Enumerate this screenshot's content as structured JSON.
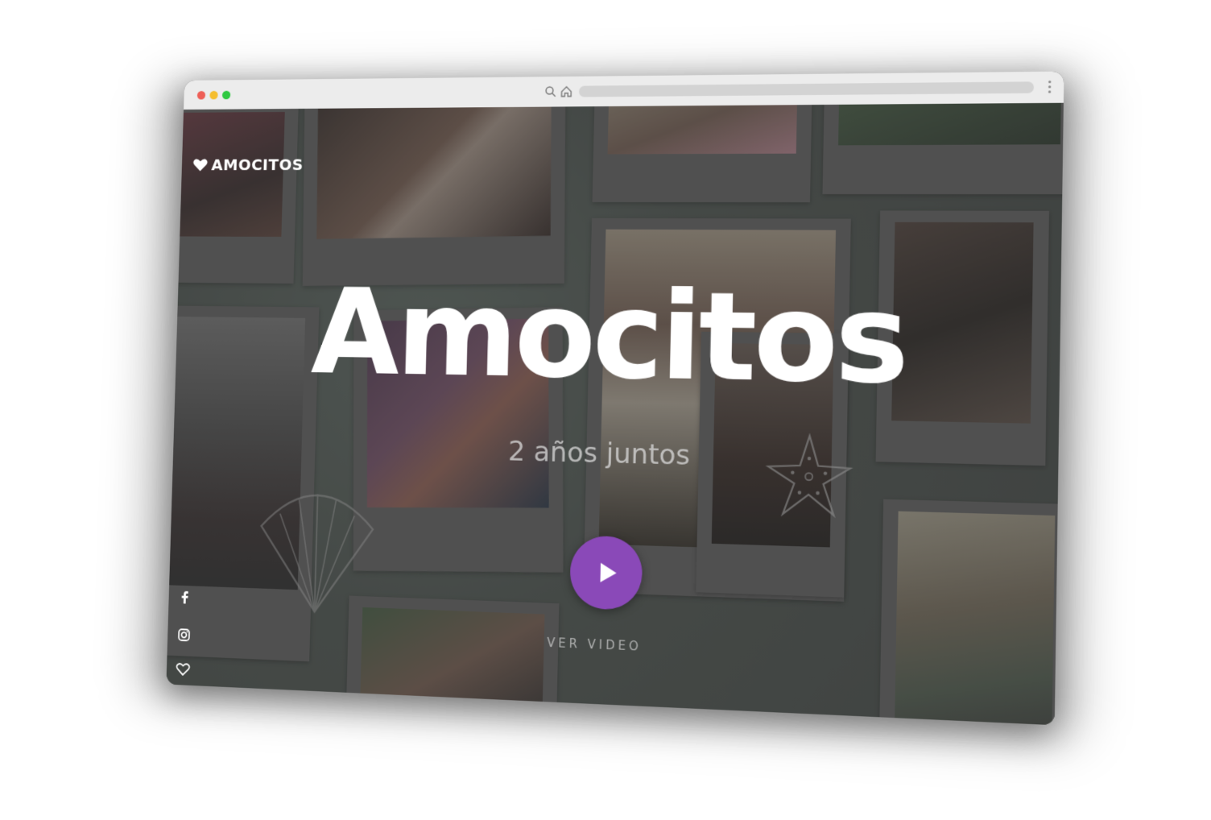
{
  "browser": {
    "icons": {
      "search": "search-icon",
      "home": "home-icon",
      "url": "url-bar",
      "menu": "kebab-menu-icon"
    }
  },
  "site": {
    "logo_text": "AMOCITOS",
    "title": "Amocitos",
    "subtitle": "2 años juntos",
    "video_label": "VER VIDEO",
    "accent_color": "#8a49b8"
  },
  "social": {
    "items": [
      "facebook-icon",
      "instagram-icon",
      "heart-icon"
    ]
  }
}
